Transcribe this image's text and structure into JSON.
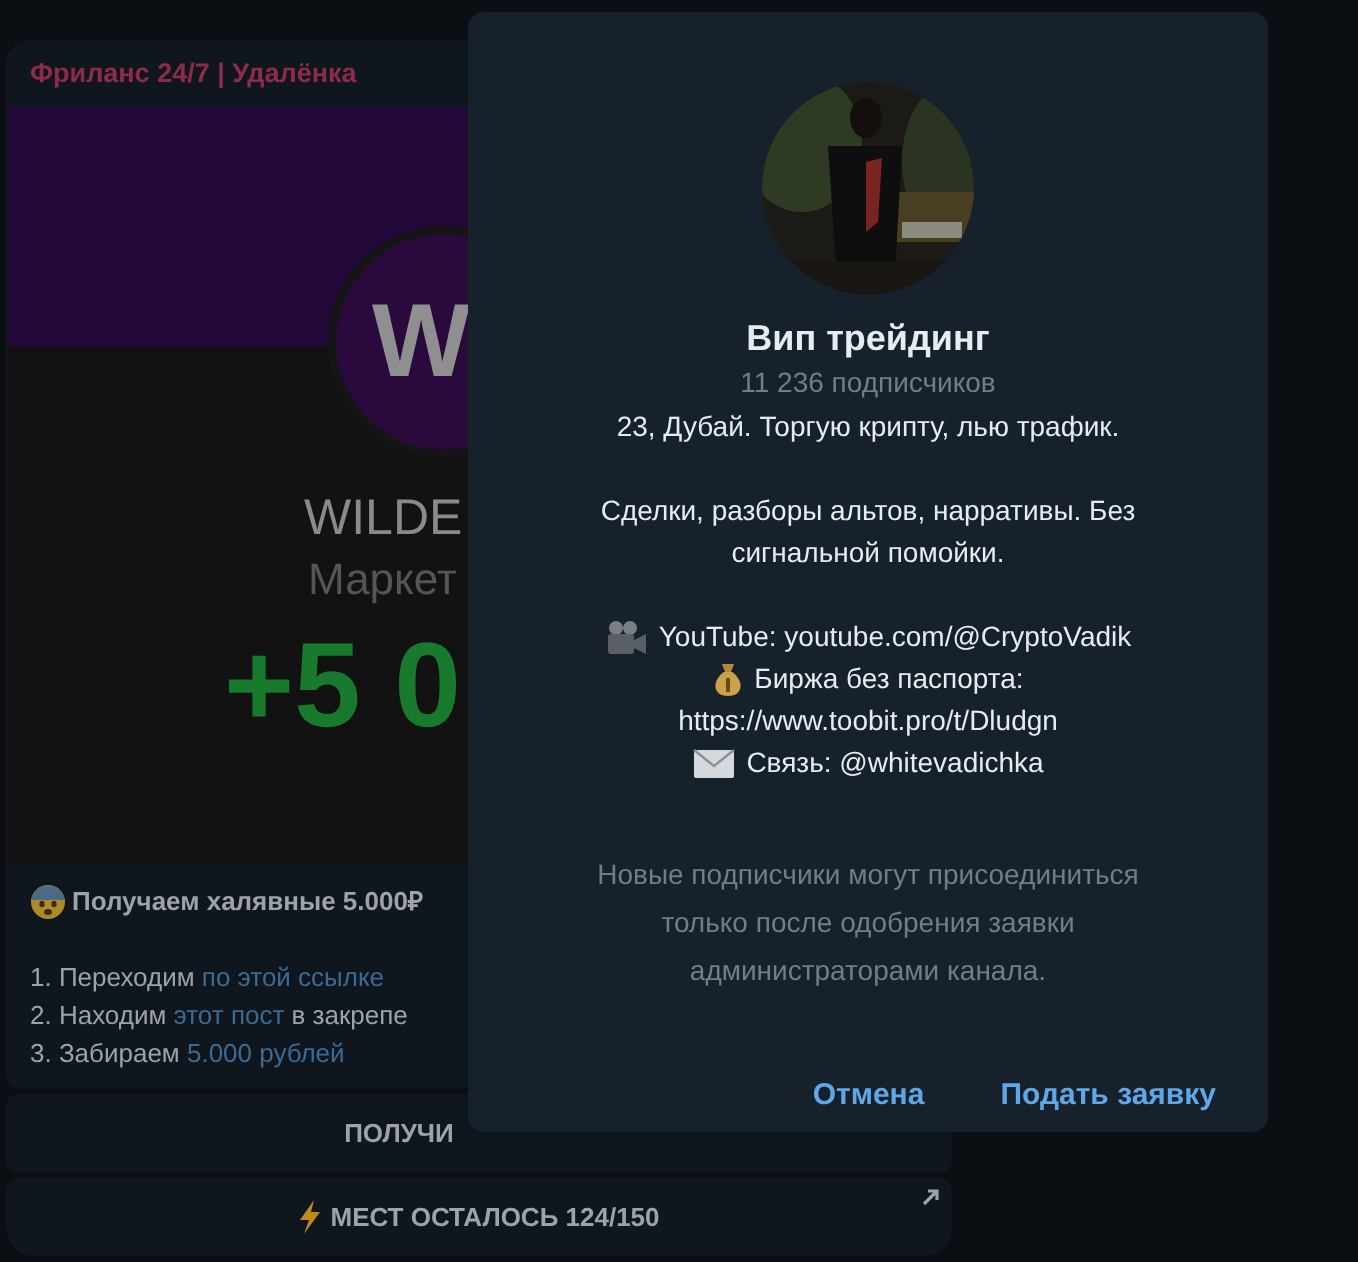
{
  "message": {
    "channel": "Фриланс 24/7 | Удалёнка",
    "image": {
      "logo_letter": "W",
      "brand": "WILDE",
      "subtitle": "Маркет",
      "amount": "+5 0"
    },
    "headline": "Получаем халявные 5.000₽",
    "steps": [
      {
        "parts": [
          {
            "kind": "text",
            "text": "1. Переходим "
          },
          {
            "kind": "link",
            "text": "по этой ссылке"
          }
        ]
      },
      {
        "parts": [
          {
            "kind": "text",
            "text": "2. Находим "
          },
          {
            "kind": "link",
            "text": "этот пост"
          },
          {
            "kind": "text",
            "text": " в закрепе"
          }
        ]
      },
      {
        "parts": [
          {
            "kind": "text",
            "text": "3. Забираем "
          },
          {
            "kind": "link",
            "text": "5.000 рублей"
          }
        ]
      }
    ],
    "buttons": [
      {
        "kind": "plain",
        "label": "ПОЛУЧИ"
      },
      {
        "kind": "url",
        "label": "МЕСТ ОСТАЛОСЬ 124/150"
      }
    ]
  },
  "dialog": {
    "avatar": {
      "kind": "picture"
    },
    "title": "Вип трейдинг",
    "subscribers": "11 236 подписчиков",
    "paragraphs": [
      [
        {
          "kind": "text",
          "text": "23, Дубай. Торгую крипту, лью трафик."
        }
      ],
      [
        {
          "kind": "text",
          "text": "Сделки, разборы альтов, нарративы. Без сигнальной помойки."
        }
      ],
      [
        {
          "kind": "video",
          "text": "YouTube: youtube.com/@CryptoVadik"
        },
        {
          "kind": "money",
          "text": "Биржа без паспорта:"
        },
        {
          "kind": "text",
          "text": "https://www.toobit.pro/t/Dludgn"
        },
        {
          "kind": "mail",
          "text": "Связь: @whitevadichka"
        }
      ]
    ],
    "notice": "Новые подписчики могут присоединиться только после одобрения заявки администраторами канала.",
    "actions": [
      {
        "label": "Отмена"
      },
      {
        "label": "Подать заявку"
      }
    ]
  }
}
